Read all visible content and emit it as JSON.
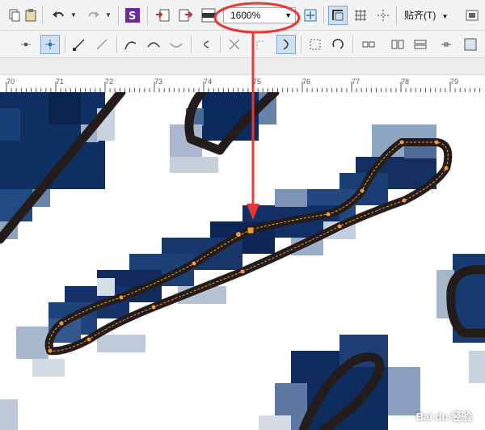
{
  "toolbar": {
    "zoom_value": "1600%",
    "snap_label": "贴齐(T)"
  },
  "ruler": {
    "labels": [
      "70",
      "71",
      "72",
      "73",
      "74",
      "75",
      "76",
      "77",
      "78",
      "79"
    ]
  },
  "watermark": {
    "text": "Bai du 经验"
  },
  "colors": {
    "toolbar_bg": "#f2f2f2",
    "annotation_red": "#e53935",
    "pixel_navy": "#0b2a5e",
    "outline_dark": "#231c1a",
    "path_orange": "#f39a3c"
  },
  "icons": [
    "paste-icon",
    "undo-icon",
    "redo-icon",
    "publish-icon",
    "import-icon",
    "export-icon",
    "pdf-icon",
    "full-screen-icon",
    "page-frame-icon",
    "view-icon",
    "grid-icon",
    "settings-icon",
    "pick-tool-icon",
    "node-tool-icon",
    "line-tool-icon",
    "curve-icon",
    "break-node-icon",
    "join-node-icon",
    "reverse-direction-icon",
    "cusp-node-icon",
    "smooth-node-icon",
    "symmetric-node-icon",
    "rotate-icon",
    "align-nodes-icon",
    "mirror-icon",
    "reflect-icon"
  ]
}
